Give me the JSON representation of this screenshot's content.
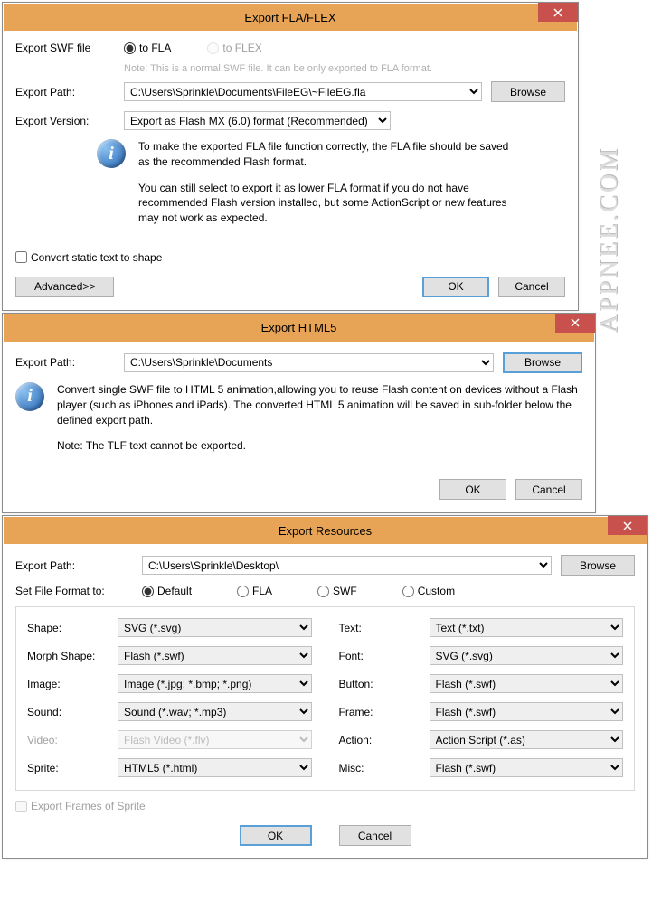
{
  "watermark": "APPNEE.COM",
  "dialog1": {
    "title": "Export FLA/FLEX",
    "exportSwfLabel": "Export SWF file",
    "toFla": "to FLA",
    "toFlex": "to FLEX",
    "note": "Note: This is a normal SWF file. It can be only exported to FLA format.",
    "exportPathLabel": "Export Path:",
    "exportPathValue": "C:\\Users\\Sprinkle\\Documents\\FileEG\\~FileEG.fla",
    "browse": "Browse",
    "exportVersionLabel": "Export Version:",
    "exportVersionValue": "Export as Flash MX (6.0) format (Recommended)",
    "infoP1": "To make the exported FLA file function correctly, the FLA file should be saved as the recommended Flash format.",
    "infoP2": "You can still select to export it as lower FLA format if you do not have recommended Flash version installed, but some ActionScript or new features may not work as expected.",
    "convertStatic": "Convert static text to shape",
    "advanced": "Advanced>>",
    "ok": "OK",
    "cancel": "Cancel"
  },
  "dialog2": {
    "title": "Export HTML5",
    "exportPathLabel": "Export Path:",
    "exportPathValue": "C:\\Users\\Sprinkle\\Documents",
    "browse": "Browse",
    "infoP1": "Convert single SWF file to HTML 5 animation,allowing you to reuse Flash content on devices without a Flash player (such as iPhones and iPads). The converted HTML 5 animation will be  saved in sub-folder below the defined export path.",
    "infoNote": "Note: The TLF text cannot be exported.",
    "ok": "OK",
    "cancel": "Cancel"
  },
  "dialog3": {
    "title": "Export  Resources",
    "exportPathLabel": "Export Path:",
    "exportPathValue": "C:\\Users\\Sprinkle\\Desktop\\",
    "browse": "Browse",
    "setFileFormatLabel": "Set File Format to:",
    "radios": {
      "default": "Default",
      "fla": "FLA",
      "swf": "SWF",
      "custom": "Custom"
    },
    "left": [
      {
        "label": "Shape:",
        "value": "SVG (*.svg)",
        "disabled": false
      },
      {
        "label": "Morph Shape:",
        "value": "Flash (*.swf)",
        "disabled": false
      },
      {
        "label": "Image:",
        "value": "Image (*.jpg; *.bmp; *.png)",
        "disabled": false
      },
      {
        "label": "Sound:",
        "value": "Sound (*.wav; *.mp3)",
        "disabled": false
      },
      {
        "label": "Video:",
        "value": "Flash Video (*.flv)",
        "disabled": true
      },
      {
        "label": "Sprite:",
        "value": "HTML5 (*.html)",
        "disabled": false
      }
    ],
    "right": [
      {
        "label": "Text:",
        "value": "Text (*.txt)",
        "disabled": false
      },
      {
        "label": "Font:",
        "value": "SVG (*.svg)",
        "disabled": false
      },
      {
        "label": "Button:",
        "value": "Flash (*.swf)",
        "disabled": false
      },
      {
        "label": "Frame:",
        "value": "Flash (*.swf)",
        "disabled": false
      },
      {
        "label": "Action:",
        "value": "Action Script (*.as)",
        "disabled": false
      },
      {
        "label": "Misc:",
        "value": "Flash (*.swf)",
        "disabled": false
      }
    ],
    "exportFramesSprite": "Export Frames of Sprite",
    "ok": "OK",
    "cancel": "Cancel"
  }
}
